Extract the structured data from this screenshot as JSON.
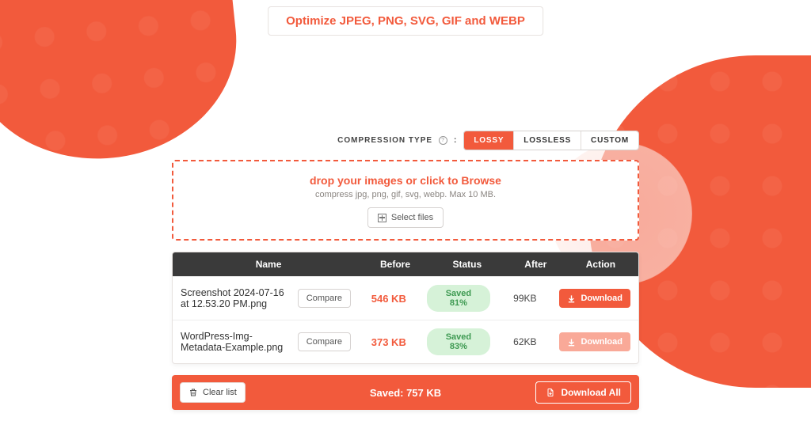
{
  "tagline": "Optimize JPEG, PNG, SVG, GIF and WEBP",
  "compression": {
    "label": "COMPRESSION TYPE",
    "options": {
      "lossy": "LOSSY",
      "lossless": "LOSSLESS",
      "custom": "CUSTOM"
    },
    "active": "lossy"
  },
  "dropzone": {
    "headline": "drop your images or click to Browse",
    "subtext": "compress jpg, png, gif, svg, webp. Max 10 MB.",
    "select_label": "Select files"
  },
  "table": {
    "headers": {
      "name": "Name",
      "before": "Before",
      "status": "Status",
      "after": "After",
      "action": "Action"
    },
    "compare_label": "Compare",
    "download_label": "Download",
    "rows": [
      {
        "name": "Screenshot 2024-07-16 at 12.53.20 PM.png",
        "before": "546 KB",
        "status": "Saved 81%",
        "after": "99KB"
      },
      {
        "name": "WordPress-Img-Metadata-Example.png",
        "before": "373 KB",
        "status": "Saved 83%",
        "after": "62KB"
      }
    ]
  },
  "footer": {
    "clear_label": "Clear list",
    "saved_text": "Saved: 757 KB",
    "download_all_label": "Download All"
  }
}
